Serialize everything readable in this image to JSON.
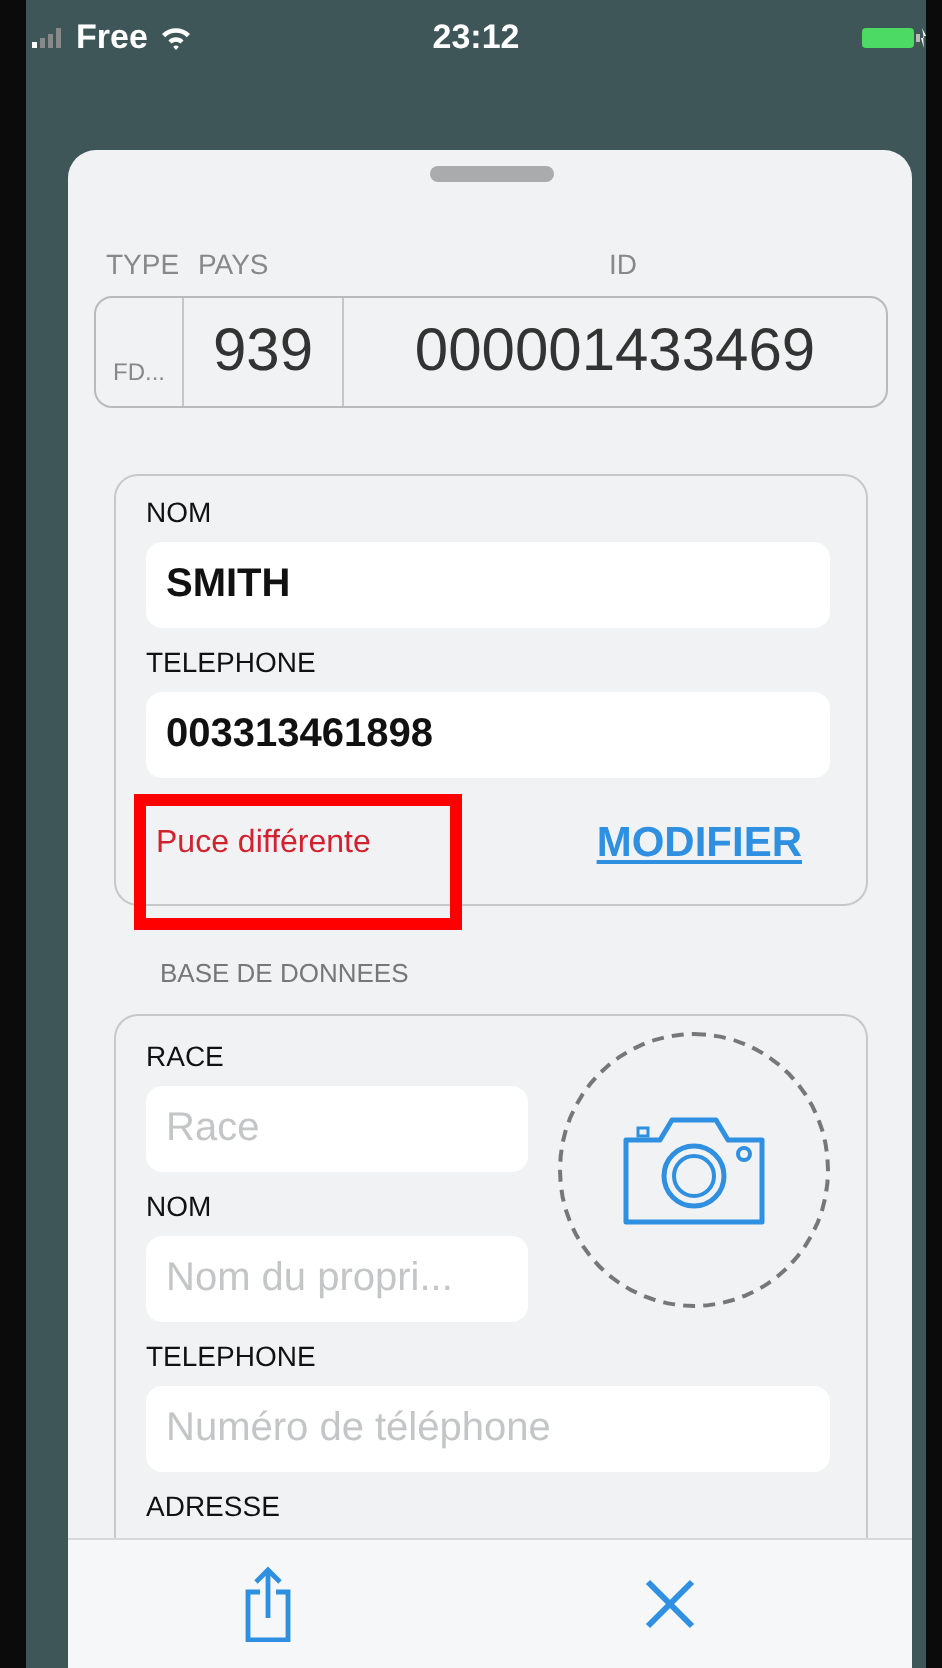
{
  "status_bar": {
    "carrier": "Free",
    "time": "23:12"
  },
  "chip_header": {
    "columns": [
      "TYPE",
      "PAYS",
      "ID"
    ]
  },
  "chip_id": {
    "type": "FD...",
    "country": "939",
    "id": "000001433469"
  },
  "owner": {
    "fields": [
      {
        "label": "NOM",
        "value": "SMITH"
      },
      {
        "label": "TELEPHONE",
        "value": "003313461898"
      }
    ],
    "warning": {
      "text": "Puce différente",
      "highlighted": true
    },
    "action": "MODIFIER"
  },
  "database": {
    "title": "BASE DE DONNEES",
    "fields": [
      {
        "label": "RACE",
        "placeholder": "Race"
      },
      {
        "label": "NOM",
        "placeholder": "Nom du propri..."
      },
      {
        "label": "TELEPHONE",
        "placeholder": "Numéro de téléphone"
      },
      {
        "label": "ADRESSE"
      }
    ]
  }
}
